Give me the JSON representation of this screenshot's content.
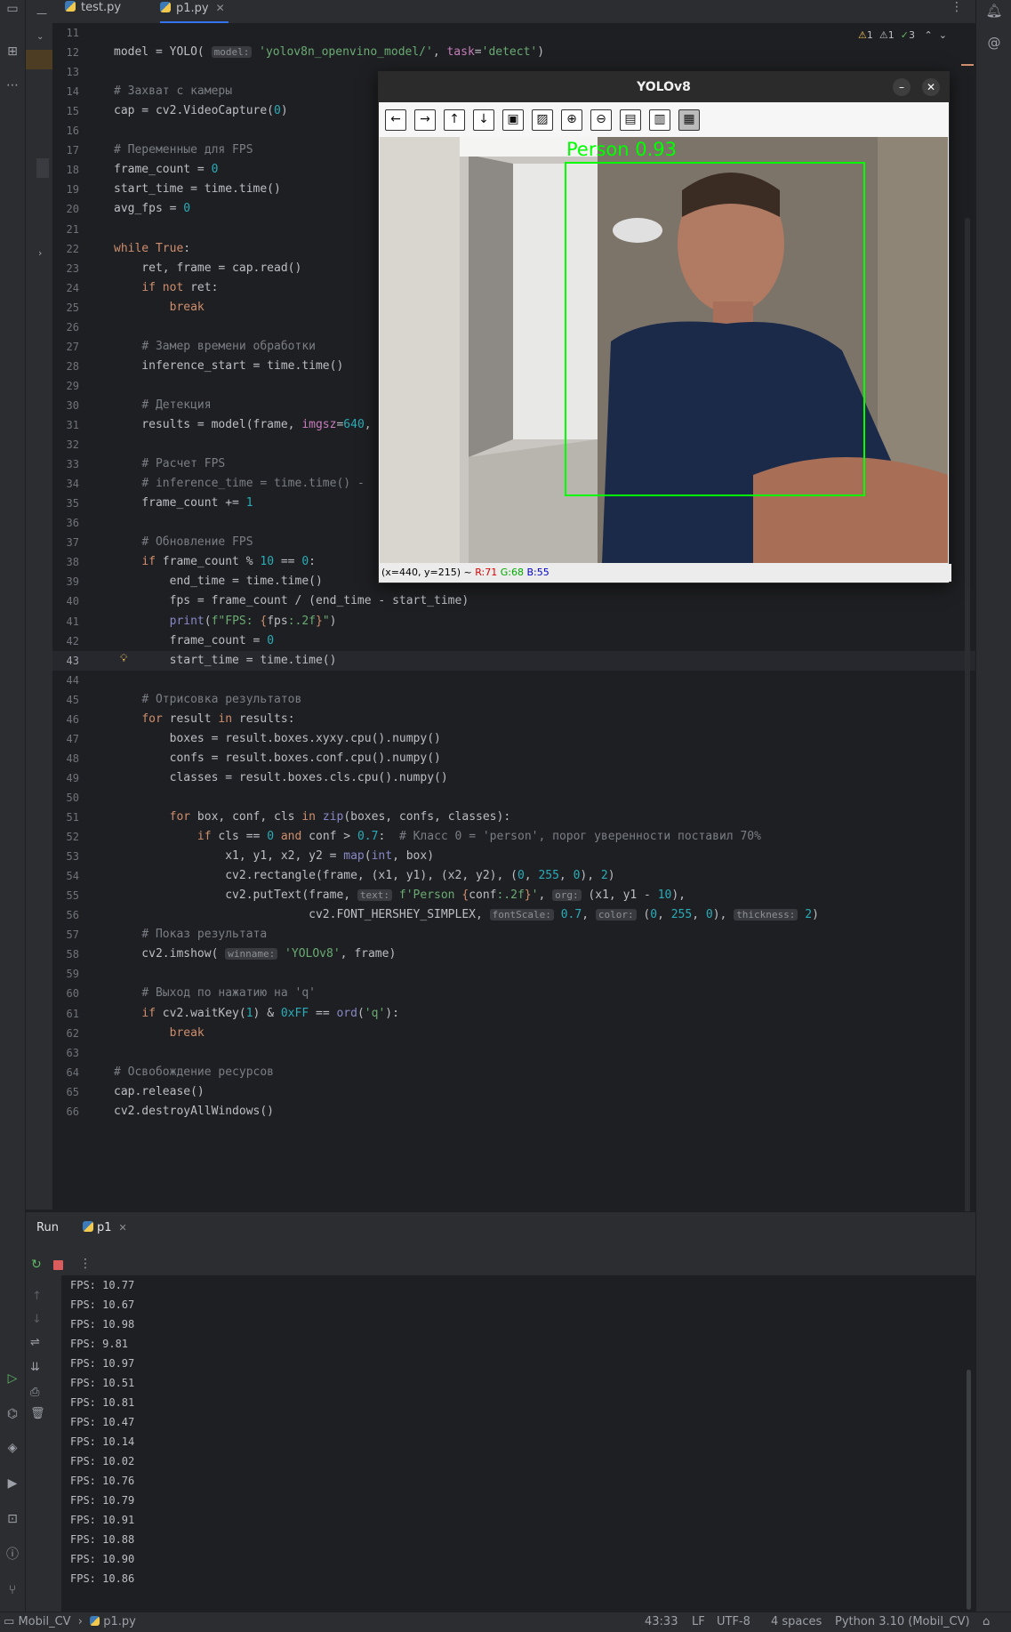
{
  "tabs": [
    {
      "label": "test.py"
    },
    {
      "label": "p1.py"
    }
  ],
  "inspections": {
    "warnings": "1",
    "weak": "1",
    "ok": "3"
  },
  "editor": {
    "current_line": "43",
    "lines": [
      {
        "n": "11",
        "html": ""
      },
      {
        "n": "12",
        "html": "model = YOLO( <span class=\"hint\">model:</span> <span class=\"str\">'yolov8n_openvino_model/'</span>, <span class=\"param\">task</span>=<span class=\"str\">'detect'</span>)"
      },
      {
        "n": "13",
        "html": ""
      },
      {
        "n": "14",
        "html": "<span class=\"cmt\"># Захват с камеры</span>"
      },
      {
        "n": "15",
        "html": "cap = cv2.VideoCapture(<span class=\"num\">0</span>)"
      },
      {
        "n": "16",
        "html": ""
      },
      {
        "n": "17",
        "html": "<span class=\"cmt\"># Переменные для FPS</span>"
      },
      {
        "n": "18",
        "html": "frame_count = <span class=\"num\">0</span>"
      },
      {
        "n": "19",
        "html": "start_time = time.time()"
      },
      {
        "n": "20",
        "html": "avg_fps = <span class=\"num\">0</span>"
      },
      {
        "n": "21",
        "html": ""
      },
      {
        "n": "22",
        "html": "<span class=\"kw\">while True</span>:"
      },
      {
        "n": "23",
        "html": "    ret, frame = cap.read()"
      },
      {
        "n": "24",
        "html": "    <span class=\"kw\">if not</span> ret:"
      },
      {
        "n": "25",
        "html": "        <span class=\"kw\">break</span>"
      },
      {
        "n": "26",
        "html": ""
      },
      {
        "n": "27",
        "html": "    <span class=\"cmt\"># Замер времени обработки</span>"
      },
      {
        "n": "28",
        "html": "    inference_start = time.time()"
      },
      {
        "n": "29",
        "html": ""
      },
      {
        "n": "30",
        "html": "    <span class=\"cmt\"># Детекция</span>"
      },
      {
        "n": "31",
        "html": "    results = model(frame, <span class=\"param\">imgsz</span>=<span class=\"num\">640</span>,"
      },
      {
        "n": "32",
        "html": ""
      },
      {
        "n": "33",
        "html": "    <span class=\"cmt\"># Расчет FPS</span>"
      },
      {
        "n": "34",
        "html": "    <span class=\"cmt\"># inference_time = time.time() -</span>"
      },
      {
        "n": "35",
        "html": "    frame_count += <span class=\"num\">1</span>"
      },
      {
        "n": "36",
        "html": ""
      },
      {
        "n": "37",
        "html": "    <span class=\"cmt\"># Обновление FPS</span>"
      },
      {
        "n": "38",
        "html": "    <span class=\"kw\">if</span> frame_count % <span class=\"num\">10</span> == <span class=\"num\">0</span>:"
      },
      {
        "n": "39",
        "html": "        end_time = time.time()"
      },
      {
        "n": "40",
        "html": "        fps = frame_count / (end_time - start_time)"
      },
      {
        "n": "41",
        "html": "        <span class=\"bi\">print</span>(<span class=\"str\">f\"FPS: </span><span class=\"kw\">{</span>fps<span class=\"str\">:.2f</span><span class=\"kw\">}</span><span class=\"str\">\"</span>)"
      },
      {
        "n": "42",
        "html": "        frame_count = <span class=\"num\">0</span>"
      },
      {
        "n": "43",
        "html": "        start_time = time.time()"
      },
      {
        "n": "44",
        "html": ""
      },
      {
        "n": "45",
        "html": "    <span class=\"cmt\"># Отрисовка результатов</span>"
      },
      {
        "n": "46",
        "html": "    <span class=\"kw\">for</span> result <span class=\"kw\">in</span> results:"
      },
      {
        "n": "47",
        "html": "        boxes = result.boxes.xyxy.cpu().numpy()"
      },
      {
        "n": "48",
        "html": "        confs = result.boxes.conf.cpu().numpy()"
      },
      {
        "n": "49",
        "html": "        classes = result.boxes.cls.cpu().numpy()"
      },
      {
        "n": "50",
        "html": ""
      },
      {
        "n": "51",
        "html": "        <span class=\"kw\">for</span> box, conf, cls <span class=\"kw\">in</span> <span class=\"bi\">zip</span>(boxes, confs, classes):"
      },
      {
        "n": "52",
        "html": "            <span class=\"kw\">if</span> cls == <span class=\"num\">0</span> <span class=\"kw\">and</span> conf > <span class=\"num\">0.7</span>:  <span class=\"cmt\"># Класс 0 = 'person', порог уверенности поставил 70%</span>"
      },
      {
        "n": "53",
        "html": "                x1, y1, x2, y2 = <span class=\"bi\">map</span>(<span class=\"bi\">int</span>, box)"
      },
      {
        "n": "54",
        "html": "                cv2.rectangle(frame, (x1, y1), (x2, y2), (<span class=\"num\">0</span>, <span class=\"num\">255</span>, <span class=\"num\">0</span>), <span class=\"num\">2</span>)"
      },
      {
        "n": "55",
        "html": "                cv2.putText(frame, <span class=\"hint\">text:</span> <span class=\"str\">f'Person </span><span class=\"kw\">{</span>conf<span class=\"str\">:.2f</span><span class=\"kw\">}</span><span class=\"str\">'</span>, <span class=\"hint\">org:</span> (x1, y1 - <span class=\"num\">10</span>),"
      },
      {
        "n": "56",
        "html": "                            cv2.FONT_HERSHEY_SIMPLEX, <span class=\"hint\">fontScale:</span> <span class=\"num\">0.7</span>, <span class=\"hint\">color:</span> (<span class=\"num\">0</span>, <span class=\"num\">255</span>, <span class=\"num\">0</span>), <span class=\"hint\">thickness:</span> <span class=\"num\">2</span>)"
      },
      {
        "n": "57",
        "html": "    <span class=\"cmt\"># Показ результата</span>"
      },
      {
        "n": "58",
        "html": "    cv2.imshow( <span class=\"hint\">winname:</span> <span class=\"str\">'YOLOv8'</span>, frame)"
      },
      {
        "n": "59",
        "html": ""
      },
      {
        "n": "60",
        "html": "    <span class=\"cmt\"># Выход по нажатию на 'q'</span>"
      },
      {
        "n": "61",
        "html": "    <span class=\"kw\">if</span> cv2.waitKey(<span class=\"num\">1</span>) & <span class=\"num\">0xFF</span> == <span class=\"bi\">ord</span>(<span class=\"str\">'q'</span>):"
      },
      {
        "n": "62",
        "html": "        <span class=\"kw\">break</span>"
      },
      {
        "n": "63",
        "html": ""
      },
      {
        "n": "64",
        "html": "<span class=\"cmt\"># Освобождение ресурсов</span>"
      },
      {
        "n": "65",
        "html": "cap.release()"
      },
      {
        "n": "66",
        "html": "cv2.destroyAllWindows()"
      }
    ]
  },
  "yolo_window": {
    "title": "YOLOv8",
    "detection_label": "Person 0.93",
    "box_color": "#00ff00",
    "status": {
      "coords": "(x=440, y=215) ~",
      "r": "R:71",
      "g": "G:68",
      "b": "B:55"
    },
    "toolbar_icons": [
      "arrow-left-icon",
      "arrow-right-icon",
      "arrow-up-icon",
      "arrow-down-icon",
      "image-icon",
      "image-edit-icon",
      "zoom-in-icon",
      "zoom-out-icon",
      "save-icon",
      "clipboard-icon",
      "settings-icon"
    ]
  },
  "run_panel": {
    "title": "Run",
    "tab_label": "p1",
    "output": [
      "FPS: 10.77",
      "FPS: 10.67",
      "FPS: 10.98",
      "FPS: 9.81",
      "FPS: 10.97",
      "FPS: 10.51",
      "FPS: 10.81",
      "FPS: 10.47",
      "FPS: 10.14",
      "FPS: 10.02",
      "FPS: 10.76",
      "FPS: 10.79",
      "FPS: 10.91",
      "FPS: 10.88",
      "FPS: 10.90",
      "FPS: 10.86"
    ]
  },
  "statusbar": {
    "project": "Mobil_CV",
    "file": "p1.py",
    "position": "43:33",
    "line_sep": "LF",
    "encoding": "UTF-8",
    "indent": "4 spaces",
    "interpreter": "Python 3.10 (Mobil_CV)"
  },
  "colors": {
    "accent": "#3574f0",
    "editor_bg": "#1e1f22",
    "panel_bg": "#2b2d30"
  }
}
